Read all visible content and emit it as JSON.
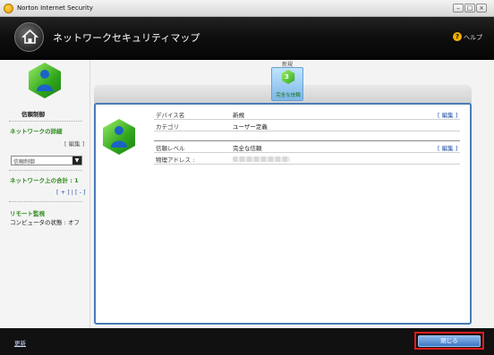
{
  "window": {
    "title": "Norton Internet Security",
    "controls": {
      "minimize": "–",
      "maximize": "□",
      "close": "×"
    }
  },
  "header": {
    "title": "ネットワークセキュリティマップ",
    "help_label": "ヘルプ",
    "help_icon": "?"
  },
  "sidebar": {
    "device_label": "信頼制御",
    "network_details_heading": "ネットワークの詳細",
    "edit_link": "[ 編集 ]",
    "select_value": "信頼制御",
    "select_arrow": "▼",
    "network_count_label": "ネットワーク上の合計 : 1",
    "pager": "[ + ] | [ - ]",
    "remote_heading": "リモート監視",
    "remote_status": "コンピュータの状態 : オフ"
  },
  "top_device": {
    "caption": "新規",
    "badge": "3",
    "subtitle": "完全な信頼"
  },
  "details": {
    "rows": [
      {
        "label": "デバイス名",
        "value": "新規",
        "action": "[ 編集 ]"
      },
      {
        "label": "カテゴリ",
        "value": "ユーザー定義",
        "action": ""
      },
      {
        "label": "信頼レベル",
        "value": "完全な信頼",
        "action": "[ 編集 ]"
      },
      {
        "label": "物理アドレス :",
        "value": "",
        "action": ""
      }
    ]
  },
  "footer": {
    "support_link": "更新",
    "close_button": "閉じる"
  },
  "colors": {
    "accent": "#4a7ab8",
    "green": "#2f8a1c",
    "highlight": "#e11b1b"
  }
}
